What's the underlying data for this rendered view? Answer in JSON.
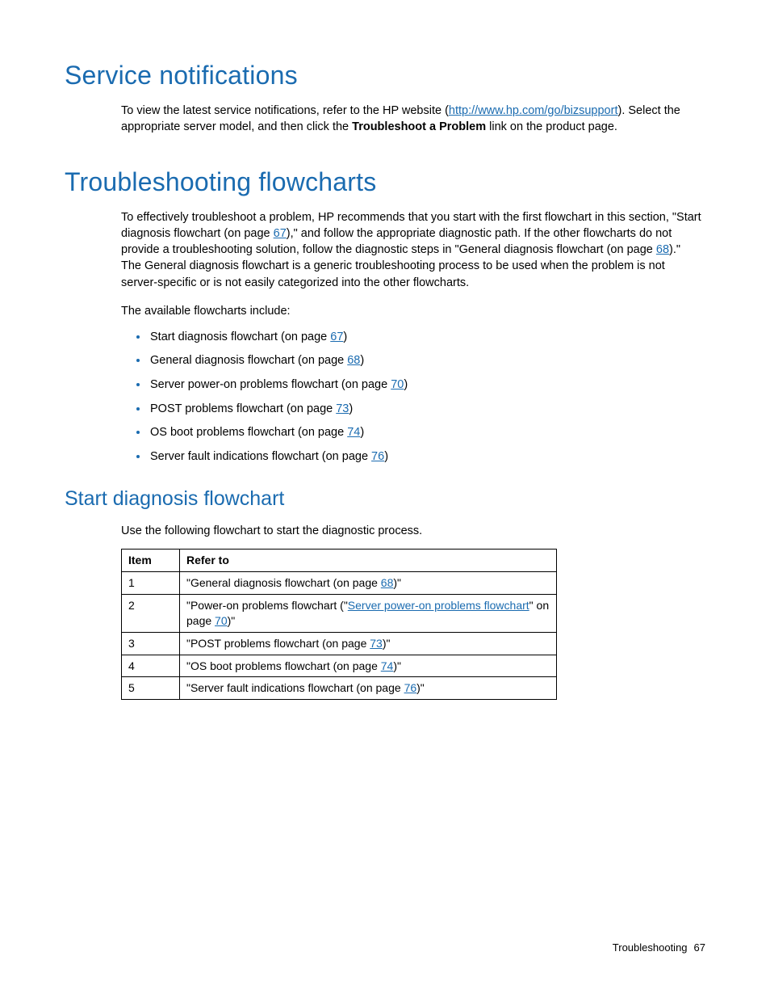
{
  "sec1": {
    "heading": "Service notifications",
    "p1_a": "To view the latest service notifications, refer to the HP website (",
    "p1_link": "http://www.hp.com/go/bizsupport",
    "p1_b": "). Select the appropriate server model, and then click the ",
    "p1_bold": "Troubleshoot a Problem",
    "p1_c": " link on the product page."
  },
  "sec2": {
    "heading": "Troubleshooting flowcharts",
    "p1_a": "To effectively troubleshoot a problem, HP recommends that you start with the first flowchart in this section, \"Start diagnosis flowchart (on page ",
    "p1_link1": "67",
    "p1_b": "),\" and follow the appropriate diagnostic path. If the other flowcharts do not provide a troubleshooting solution, follow the diagnostic steps in \"General diagnosis flowchart (on page ",
    "p1_link2": "68",
    "p1_c": ").\" The General diagnosis flowchart is a generic troubleshooting process to be used when the problem is not server-specific or is not easily categorized into the other flowcharts.",
    "p2": "The available flowcharts include:",
    "list": [
      {
        "a": "Start diagnosis flowchart (on page ",
        "link": "67",
        "b": ")"
      },
      {
        "a": "General diagnosis flowchart (on page ",
        "link": "68",
        "b": ")"
      },
      {
        "a": "Server power-on problems flowchart (on page ",
        "link": "70",
        "b": ")"
      },
      {
        "a": "POST problems flowchart (on page ",
        "link": "73",
        "b": ")"
      },
      {
        "a": "OS boot problems flowchart (on page ",
        "link": "74",
        "b": ")"
      },
      {
        "a": "Server fault indications flowchart (on page ",
        "link": "76",
        "b": ")"
      }
    ]
  },
  "sec3": {
    "heading": "Start diagnosis flowchart",
    "p1": "Use the following flowchart to start the diagnostic process.",
    "th_item": "Item",
    "th_refer": "Refer to",
    "rows": [
      {
        "n": "1",
        "a": "\"General diagnosis flowchart (on page ",
        "link": "68",
        "b": ")\""
      },
      {
        "n": "2",
        "a": "\"Power-on problems flowchart (\"",
        "link": "Server power-on problems flowchart",
        "mid": "\" on page ",
        "link2": "70",
        "b": ")\""
      },
      {
        "n": "3",
        "a": "\"POST problems flowchart (on page ",
        "link": "73",
        "b": ")\""
      },
      {
        "n": "4",
        "a": "\"OS boot problems flowchart (on page ",
        "link": "74",
        "b": ")\""
      },
      {
        "n": "5",
        "a": "\"Server fault indications flowchart (on page ",
        "link": "76",
        "b": ")\""
      }
    ]
  },
  "footer": {
    "section": "Troubleshooting",
    "page": "67"
  }
}
